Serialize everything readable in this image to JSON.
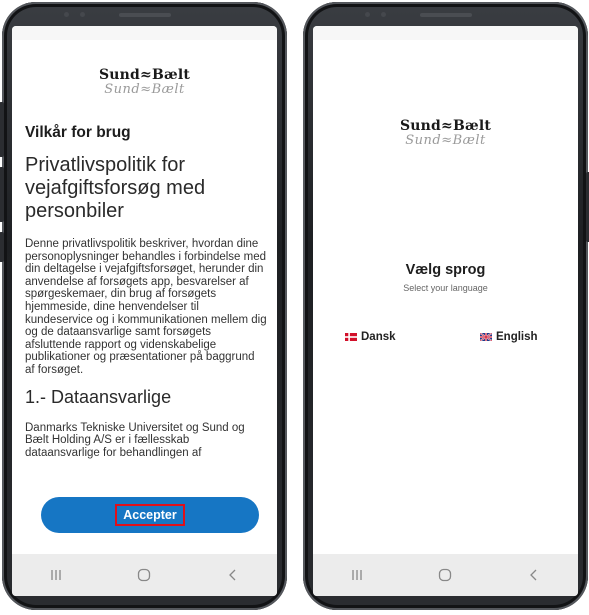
{
  "colors": {
    "accent": "#1676c4",
    "highlight_border": "#e0101a",
    "navbar_bg": "#ececec"
  },
  "brand": {
    "line1": "Sund≈Bælt",
    "line2": "Sund≈Bælt"
  },
  "terms_screen": {
    "heading": "Vilkår for brug",
    "title": "Privatlivspolitik for vejafgiftsforsøg med personbiler",
    "intro_text": "Denne privatlivspolitik beskriver, hvordan dine personoplysninger behandles i forbindelse med din deltagelse i vejafgiftsforsøget, herunder din anvendelse af forsøgets app, besvarelser af spørgeskemaer, din brug af forsøgets hjemmeside, dine henvendelser til kundeservice og i kommunikationen mellem dig og de dataansvarlige samt forsøgets afsluttende rapport og videnskabelige publikationer og præsentationer på baggrund af forsøget.",
    "section_heading": "1.- Dataansvarlige",
    "section_text": "Danmarks Tekniske Universitet og Sund og Bælt Holding A/S er i fællesskab dataansvarlige for behandlingen af",
    "accept_label": "Accepter"
  },
  "language_screen": {
    "title": "Vælg sprog",
    "subtitle": "Select your language",
    "options": [
      {
        "flag": "denmark-flag-icon",
        "label": "Dansk"
      },
      {
        "flag": "uk-flag-icon",
        "label": "English"
      }
    ]
  },
  "navbar": {
    "icons": [
      "recent-apps-icon",
      "home-icon",
      "back-icon"
    ]
  }
}
